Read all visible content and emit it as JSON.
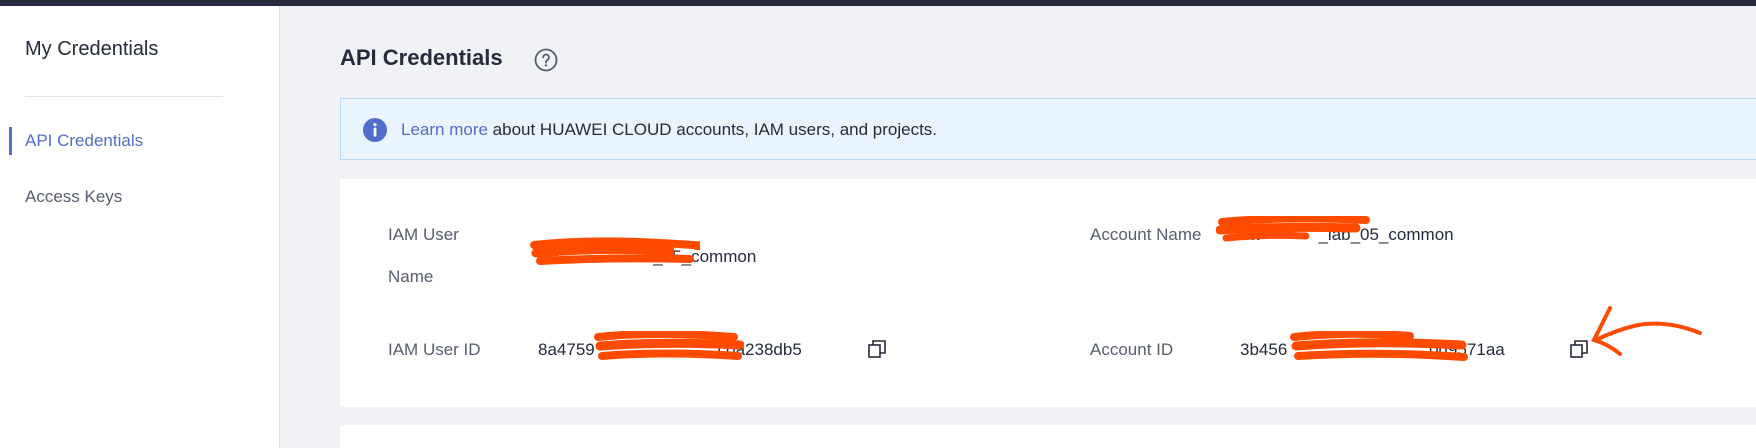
{
  "sidebar": {
    "title": "My Credentials",
    "items": [
      {
        "label": "API Credentials",
        "active": true
      },
      {
        "label": "Access Keys",
        "active": false
      }
    ]
  },
  "main": {
    "title": "API Credentials",
    "info": {
      "link_text": "Learn more",
      "text": " about HUAWEI CLOUD accounts, IAM users, and projects."
    },
    "fields": {
      "iam_user_name_label_line1": "IAM User",
      "iam_user_name_label_line2": "Name",
      "iam_user_name_value": "hw          _05_common",
      "account_name_label": "Account Name",
      "account_name_value": "hw      _lab_05_common",
      "iam_user_id_label": "IAM User ID",
      "iam_user_id_value": "8a4759             c0a238db5",
      "account_id_label": "Account ID",
      "account_id_value": "3b456               0d9571aa"
    }
  },
  "colors": {
    "accent": "#526ecc",
    "redaction": "#ff4b00",
    "topbar": "#252b3a"
  },
  "icons": [
    "help-icon",
    "info-icon",
    "copy-icon",
    "copy-icon"
  ]
}
